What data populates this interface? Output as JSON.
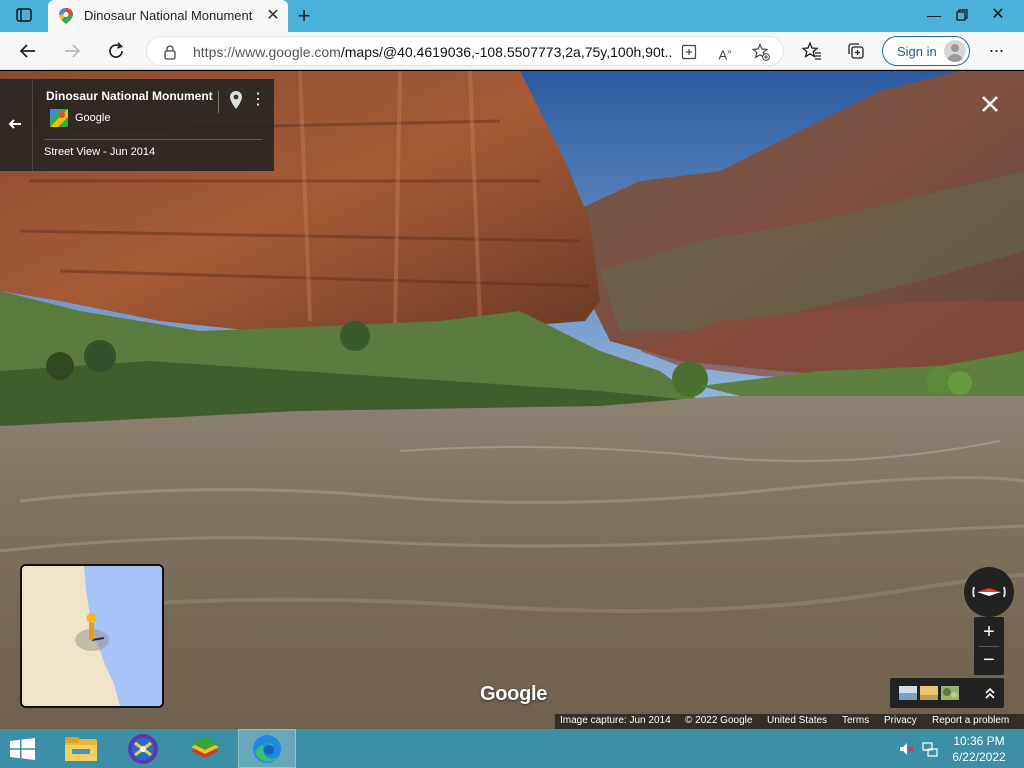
{
  "browser": {
    "tab_title": "Dinosaur National Monument - Google Maps",
    "url_host": "https://www.google.com",
    "url_path": "/maps/@40.4619036,-108.5507773,2a,75y,100h,90t...",
    "sign_in_label": "Sign in",
    "icons": {
      "tab_actions": "tab-actions-icon",
      "new_tab": "plus-icon",
      "back": "back-arrow-icon",
      "forward": "forward-arrow-icon",
      "refresh": "refresh-icon",
      "lock": "lock-icon",
      "app_available": "app-available-icon",
      "read_aloud": "read-aloud-icon",
      "add_favorite": "star-plus-icon",
      "favorites": "favorites-icon",
      "collections": "collections-icon",
      "more": "more-icon"
    }
  },
  "street_view": {
    "place_title": "Dinosaur National Monument",
    "provider": "Google",
    "capture_label": "Street View - Jun 2014",
    "watermark": "Google",
    "attribution": {
      "image_capture": "Image capture: Jun 2014",
      "copyright": "© 2022 Google",
      "region": "United States",
      "terms": "Terms",
      "privacy": "Privacy",
      "report": "Report a problem"
    },
    "zoom_in": "+",
    "zoom_out": "−",
    "colors": {
      "panel": "#222222",
      "map_land": "#f0e4c8",
      "map_water": "#a7c4f8",
      "pegman": "#f5b51b",
      "compass_needle": "#e53935"
    }
  },
  "taskbar": {
    "apps": [
      "file-explorer",
      "app-2",
      "bluestacks",
      "edge"
    ],
    "time": "10:36 PM",
    "date": "6/22/2022"
  }
}
